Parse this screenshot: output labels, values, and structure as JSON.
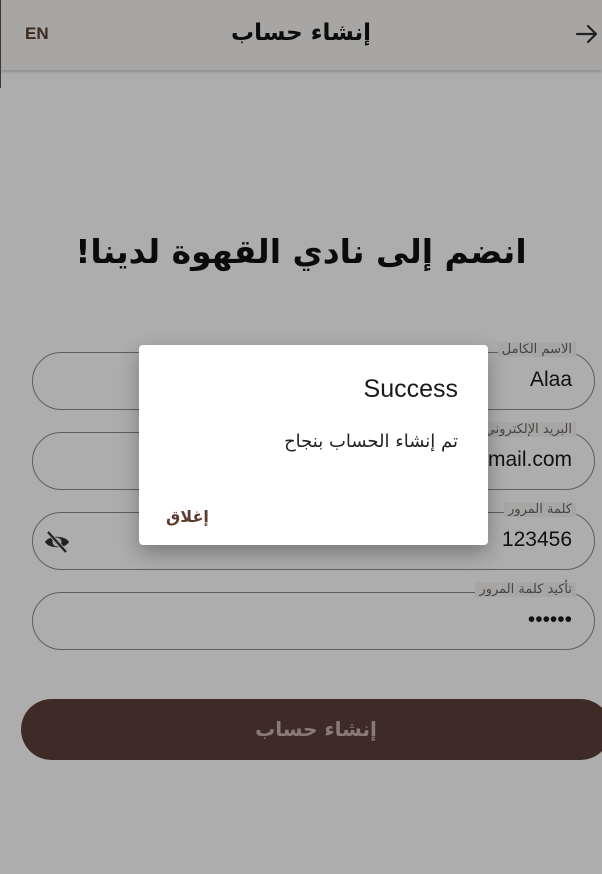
{
  "appbar": {
    "lang_button": "EN",
    "title": "إنشاء حساب",
    "back_icon": "arrow-right-icon"
  },
  "heading": "انضم إلى نادي القهوة لدينا!",
  "form": {
    "full_name": {
      "label": "الاسم الكامل",
      "value": "Alaa"
    },
    "email": {
      "label": "البريد الإلكتروني",
      "value": "mail.com"
    },
    "password": {
      "label": "كلمة المرور",
      "value": "123456",
      "toggle_icon": "eye-off-icon"
    },
    "confirm_password": {
      "label": "تأكيد كلمة المرور",
      "value": "••••••"
    },
    "submit_label": "إنشاء حساب"
  },
  "dialog": {
    "title": "Success",
    "message": "تم إنشاء الحساب بنجاح",
    "close_label": "إغلاق"
  },
  "colors": {
    "brand_brown": "#5d4037",
    "accent_text": "#5b3e2f",
    "background": "#f7f5f4"
  }
}
